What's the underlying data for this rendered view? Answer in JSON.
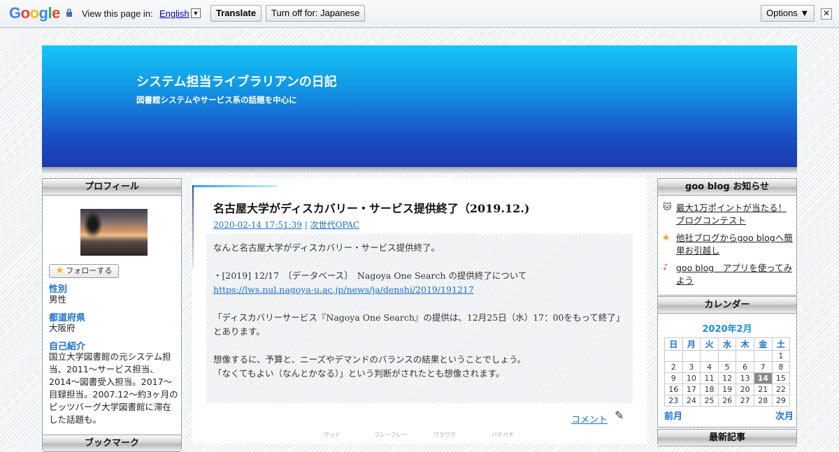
{
  "translate_bar": {
    "logo": "Google",
    "view_label": "View this page in:",
    "language": "English",
    "translate_button": "Translate",
    "turn_off_button": "Turn off for: Japanese",
    "options_button": "Options ▼",
    "close_glyph": "✕"
  },
  "header": {
    "title": "システム担当ライブラリアンの日記",
    "subtitle": "図書館システムやサービス系の話題を中心に"
  },
  "profile": {
    "heading": "プロフィール",
    "follow_button": "フォローする",
    "fields": [
      {
        "label": "性別",
        "value": "男性"
      },
      {
        "label": "都道府県",
        "value": "大阪府"
      },
      {
        "label": "自己紹介",
        "value": "国立大学図書館の元システム担当、2011～サービス担当、2014～図書受入担当。2017～目録担当。2007.12～約3ヶ月のピッツバーグ大学図書館に滞在した話題も。"
      }
    ],
    "next_heading": "ブックマーク"
  },
  "post": {
    "title": "名古屋大学がディスカバリー・サービス提供終了（2019.12.)",
    "date": "2020-02-14 17:51:39",
    "separator": " | ",
    "category": "次世代OPAC",
    "body": {
      "p1": "なんと名古屋大学がディスカバリー・サービス提供終了。",
      "p2": "・[2019] 12/17　〔データベース〕　Nagoya One Search の提供終了について",
      "p2_link": "https://lws.nul.nagoya-u.ac.jp/news/ja/denshi/2019/191217",
      "p3a": "「ディスカバリーサービス『Nagoya One Search』の提供は、12月25日（水）17：00をもって終了」",
      "p3b": "とあります。",
      "p4a": "想像するに、予算と、ニーズやデマンドのバランスの結果ということでしょう。",
      "p4b": "「なくてもよい（なんとかなる）」という判断がされたとも想像されます。"
    },
    "comment_link": "コメント",
    "reactions": [
      "グッド",
      "フレーフレー",
      "ワクワク",
      "パチパチ"
    ]
  },
  "notices": {
    "heading": "goo blog お知らせ",
    "items": [
      {
        "icon": "cat-icon",
        "text": "最大1万ポイントが当たる！ブログコンテスト"
      },
      {
        "icon": "diamond-icon",
        "text": "他社ブログからgoo blogへ簡単お引越し"
      },
      {
        "icon": "note-icon",
        "text": "goo blog　アプリを使ってみよう"
      }
    ]
  },
  "calendar": {
    "heading": "カレンダー",
    "month_title": "2020年2月",
    "weekdays": [
      "日",
      "月",
      "火",
      "水",
      "木",
      "金",
      "土"
    ],
    "weeks": [
      [
        "",
        "",
        "",
        "",
        "",
        "",
        "1"
      ],
      [
        "2",
        "3",
        "4",
        "5",
        "6",
        "7",
        "8"
      ],
      [
        "9",
        "10",
        "11",
        "12",
        "13",
        "14",
        "15"
      ],
      [
        "16",
        "17",
        "18",
        "19",
        "20",
        "21",
        "22"
      ],
      [
        "23",
        "24",
        "25",
        "26",
        "27",
        "28",
        "29"
      ]
    ],
    "highlight_day": "14",
    "prev": "前月",
    "next": "次月"
  },
  "recent": {
    "heading": "最新記事"
  },
  "colors": {
    "accent": "#1a6fd0",
    "header_top": "#16c5f7",
    "header_bottom": "#1c38ac"
  }
}
